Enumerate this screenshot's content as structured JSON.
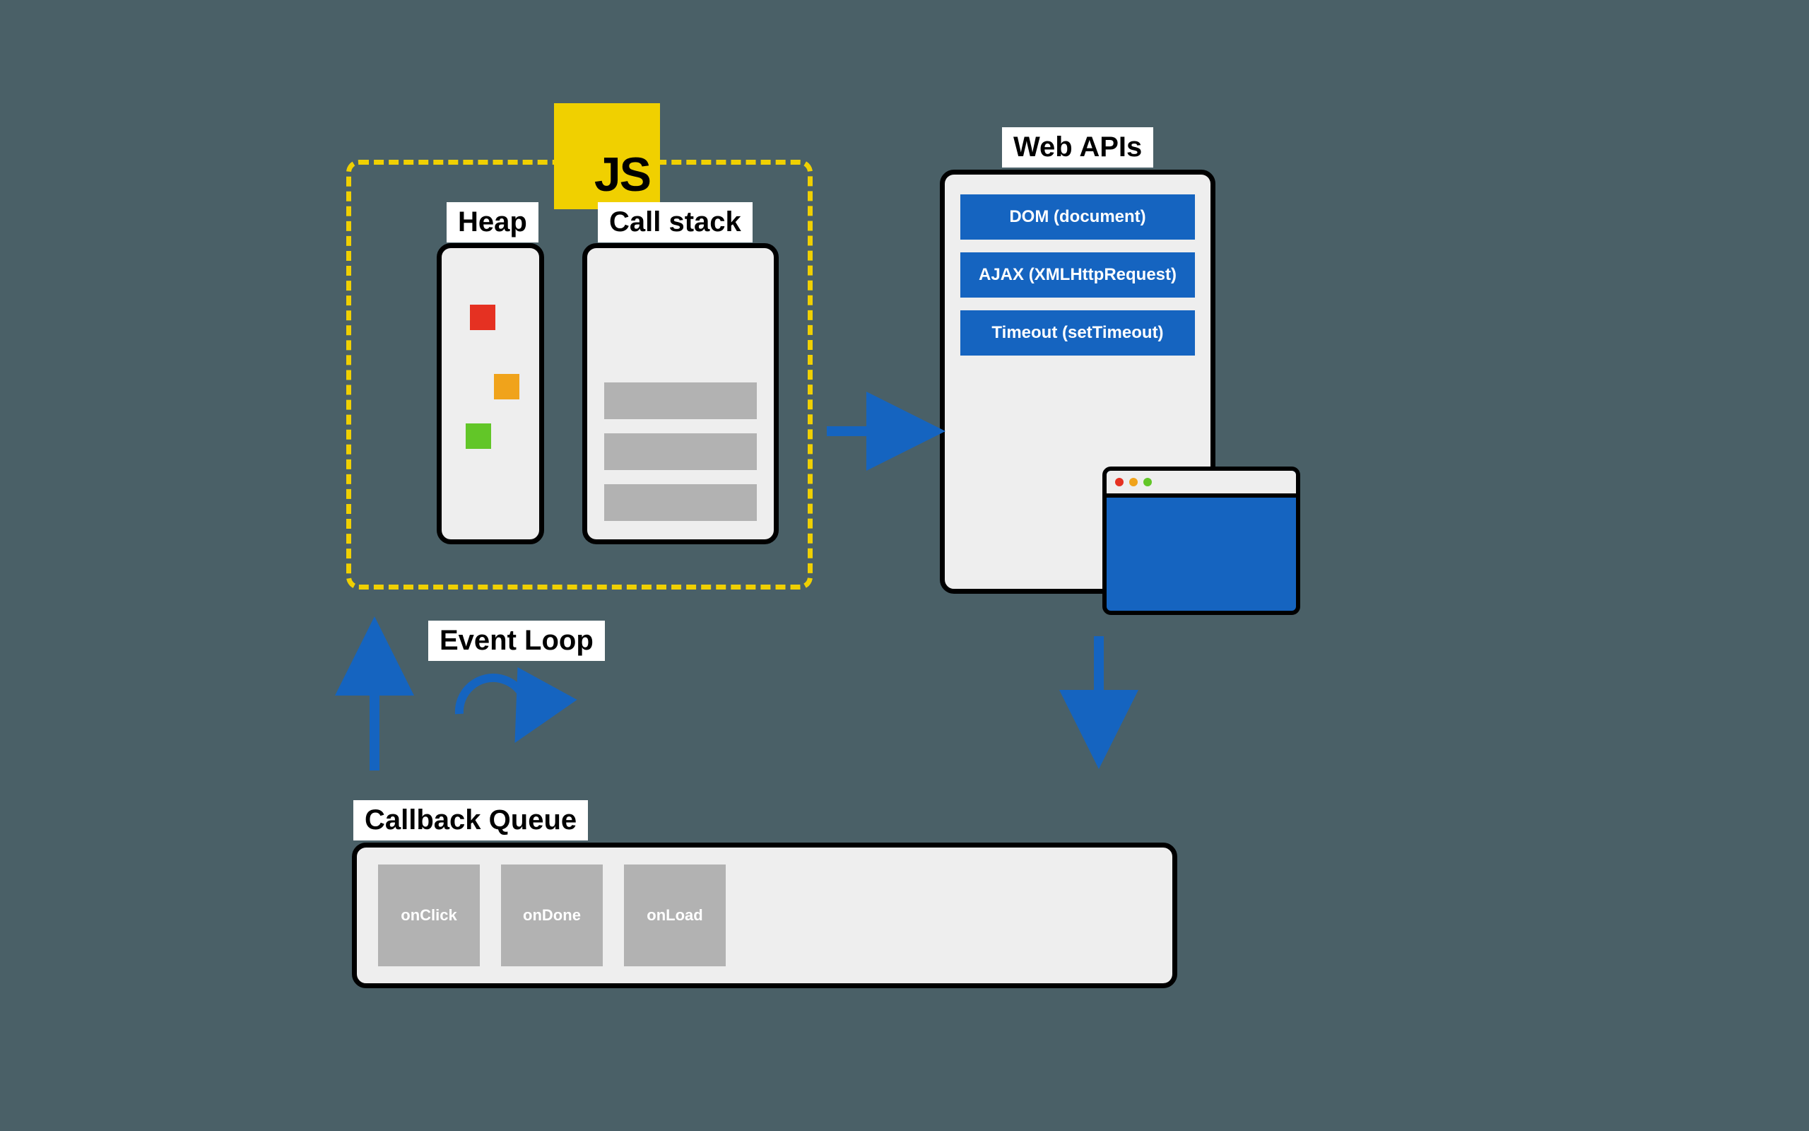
{
  "js_engine": {
    "logo_text": "JS",
    "heap_label": "Heap",
    "callstack_label": "Call stack",
    "heap_squares": [
      "red",
      "orange",
      "green"
    ],
    "stack_items_count": 3
  },
  "web_apis": {
    "label": "Web APIs",
    "items": [
      "DOM (document)",
      "AJAX (XMLHttpRequest)",
      "Timeout (setTimeout)"
    ]
  },
  "event_loop": {
    "label": "Event Loop"
  },
  "callback_queue": {
    "label": "Callback Queue",
    "items": [
      "onClick",
      "onDone",
      "onLoad"
    ]
  },
  "colors": {
    "accent_blue": "#1564c0",
    "js_yellow": "#f0d000",
    "bg": "#4a6067"
  }
}
